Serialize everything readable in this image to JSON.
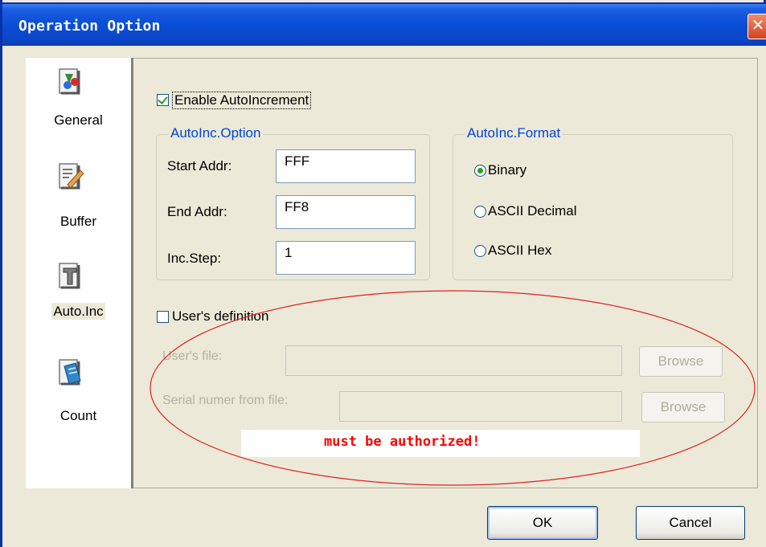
{
  "window": {
    "title": "Operation Option",
    "close_label": "✕"
  },
  "sidebar": {
    "items": [
      {
        "label": "General",
        "icon": "general-options-icon",
        "selected": false
      },
      {
        "label": "Buffer",
        "icon": "buffer-icon",
        "selected": false
      },
      {
        "label": "Auto.Inc",
        "icon": "auto-inc-icon",
        "selected": true
      },
      {
        "label": "Count",
        "icon": "count-icon",
        "selected": false
      }
    ]
  },
  "autoinc": {
    "enable_label": "Enable AutoIncrement",
    "enabled": true,
    "option_group": {
      "legend": "AutoInc.Option",
      "start_label": "Start Addr:",
      "start_value": "FFF",
      "end_label": "End Addr:",
      "end_value": "FF8",
      "step_label": "Inc.Step:",
      "step_value": "1"
    },
    "format_group": {
      "legend": "AutoInc.Format",
      "options": [
        "Binary",
        "ASCII Decimal",
        "ASCII Hex"
      ],
      "selected": "Binary"
    }
  },
  "user_def": {
    "checkbox_label": "User's definition",
    "checked": false,
    "file_label": "User's file:",
    "serial_label": "Serial numer from file:",
    "browse_label": "Browse",
    "annotation": "must be authorized!",
    "annotation_color": "#ff0000"
  },
  "footer": {
    "ok_label": "OK",
    "cancel_label": "Cancel"
  },
  "colors": {
    "title_bar": "#0a45c8",
    "accent_legend": "#0046d5",
    "check_green": "#21a121"
  }
}
